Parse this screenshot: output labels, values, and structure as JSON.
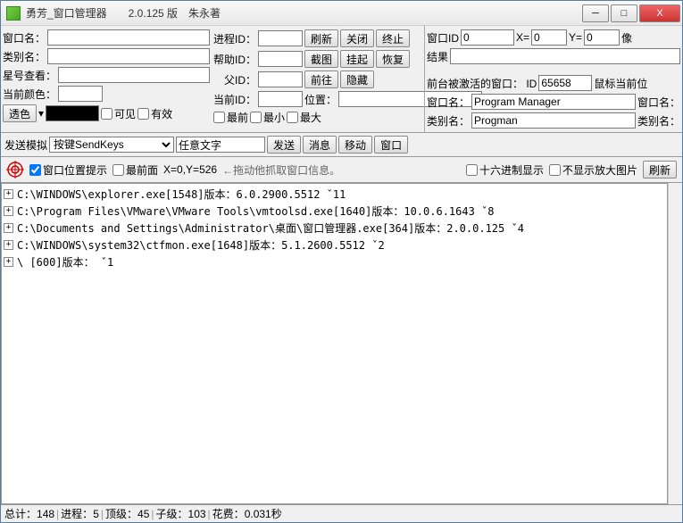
{
  "title": "勇芳_窗口管理器　　2.0.125 版　朱永著",
  "winbtns": {
    "min": "─",
    "max": "□",
    "close": "X"
  },
  "left": {
    "winname_lbl": "窗口名：",
    "class_lbl": "类别名：",
    "star_lbl": "星号查看：",
    "color_lbl": "当前颜色：",
    "trans_btn": "透色",
    "visible": "可见",
    "enabled": "有效"
  },
  "mid": {
    "pid_lbl": "进程ID：",
    "help_lbl": "帮助ID：",
    "parent_lbl": "父ID：",
    "curid_lbl": "当前ID：",
    "pos_lbl": "位置：",
    "refresh": "刷新",
    "close": "关闭",
    "stop": "终止",
    "capture": "截图",
    "suspend": "挂起",
    "restore": "恢复",
    "front": "前往",
    "hide": "隐藏",
    "topmost": "最前",
    "min": "最小",
    "max": "最大"
  },
  "right": {
    "winid_lbl": "窗口ID",
    "winid_val": "0",
    "x_lbl": "X=",
    "x_val": "0",
    "y_lbl": "Y=",
    "y_val": "0",
    "px_lbl": "像",
    "result_lbl": "结果",
    "active_lbl": "前台被激活的窗口： ID",
    "active_val": "65658",
    "mouse_lbl": "鼠标当前位",
    "winname2_lbl": "窗口名：",
    "winname2_val": "Program Manager",
    "winname3_lbl": "窗口名：",
    "class2_lbl": "类别名：",
    "class2_val": "Progman",
    "class3_lbl": "类别名："
  },
  "send": {
    "lbl": "发送模拟",
    "combo_val": "按键SendKeys",
    "anytext": "任意文字",
    "send_btn": "发送",
    "msg_btn": "消息",
    "move_btn": "移动",
    "win_btn": "窗口"
  },
  "target": {
    "showpos": "窗口位置提示",
    "topmost": "最前面",
    "coords": "X=0,Y=526",
    "hint": "←拖动他抓取窗口信息。",
    "hex": "十六进制显示",
    "noimg": "不显示放大图片",
    "refresh": "刷新"
  },
  "tree": [
    "C:\\WINDOWS\\explorer.exe[1548]版本：6.0.2900.5512 ˇ11",
    "C:\\Program Files\\VMware\\VMware Tools\\vmtoolsd.exe[1640]版本：10.0.6.1643 ˇ8",
    "C:\\Documents and Settings\\Administrator\\桌面\\窗口管理器.exe[364]版本：2.0.0.125 ˇ4",
    "C:\\WINDOWS\\system32\\ctfmon.exe[1648]版本：5.1.2600.5512 ˇ2",
    "\\ [600]版本： ˇ1"
  ],
  "status": {
    "total_lbl": "总计：",
    "total": "148",
    "proc_lbl": "进程：",
    "proc": "5",
    "top_lbl": "顶级：",
    "top": "45",
    "child_lbl": "子级：",
    "child": "103",
    "time_lbl": "花费：",
    "time": "0.031秒"
  }
}
